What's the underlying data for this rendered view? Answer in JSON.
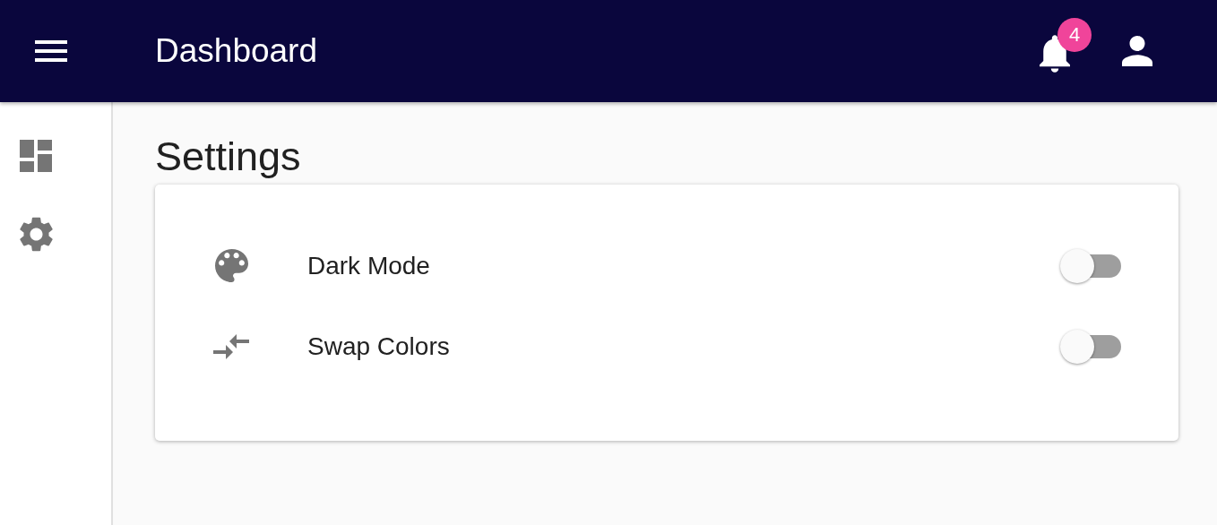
{
  "app_bar": {
    "title": "Dashboard",
    "notifications_badge": "4"
  },
  "page": {
    "heading": "Settings"
  },
  "settings": [
    {
      "label": "Dark Mode",
      "on": false
    },
    {
      "label": "Swap Colors",
      "on": false
    }
  ]
}
